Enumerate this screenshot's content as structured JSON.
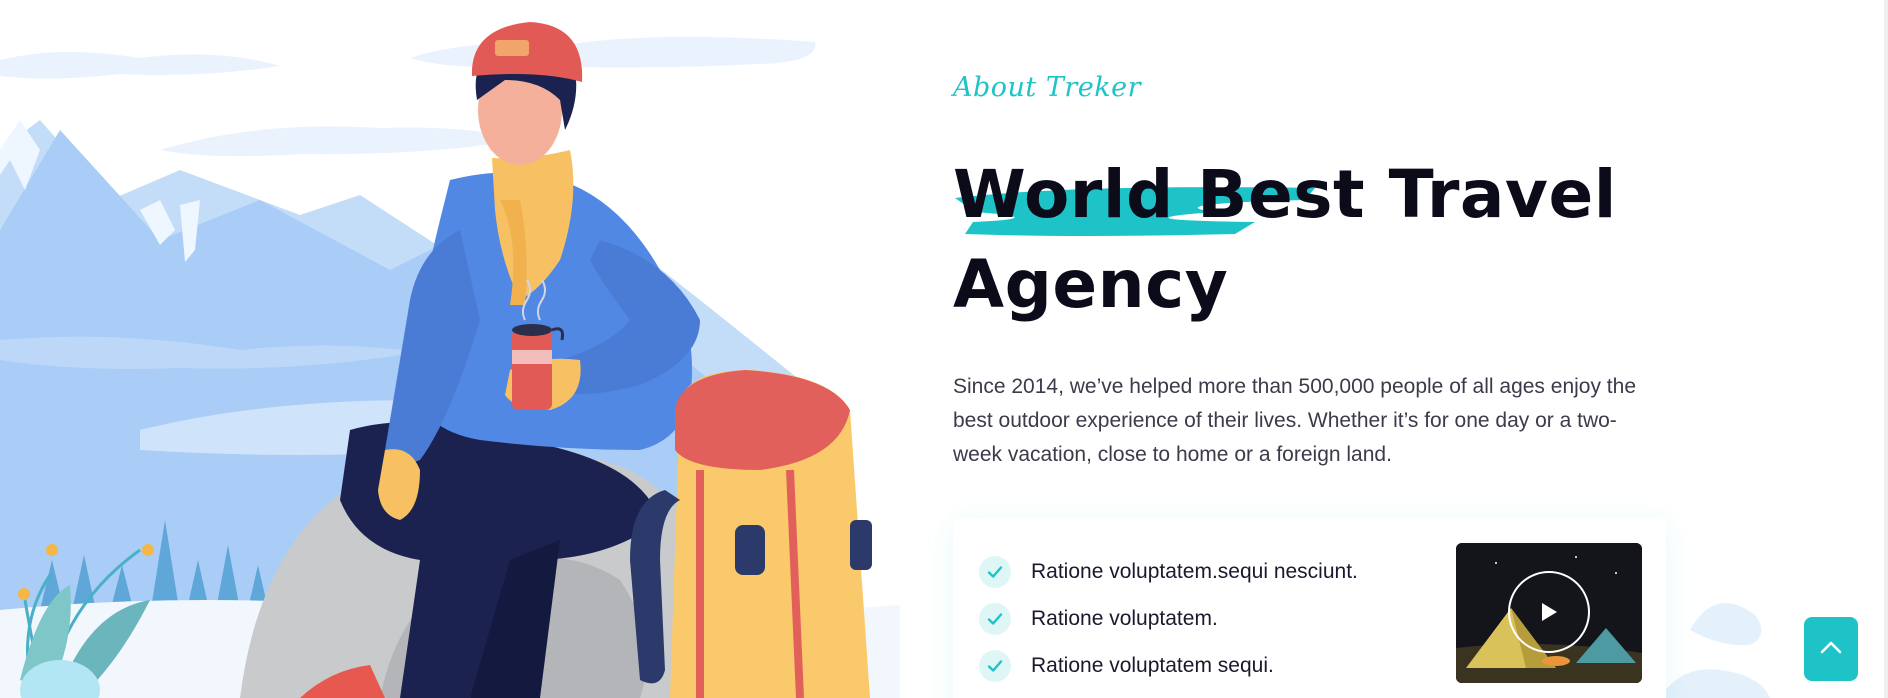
{
  "about": {
    "subtitle": "About Treker",
    "title": "World Best Travel Agency",
    "description": "Since 2014, we’ve helped more than 500,000 people of all ages enjoy the best outdoor experience of their lives. Whether it’s for one day or a two-week vacation, close to home or a foreign land."
  },
  "features": [
    {
      "text": "Ratione voluptatem.sequi nesciunt."
    },
    {
      "text": "Ratione voluptatem."
    },
    {
      "text": "Ratione voluptatem sequi."
    }
  ],
  "video": {
    "icon": "play-icon"
  },
  "scroll_top": {
    "icon": "chevron-up-icon"
  },
  "colors": {
    "accent": "#1ec3c8",
    "heading": "#0b0b1a",
    "body_text": "#3b3b4a",
    "mountain_light": "#a9cdf6",
    "mountain_dark": "#7fb3ec"
  }
}
